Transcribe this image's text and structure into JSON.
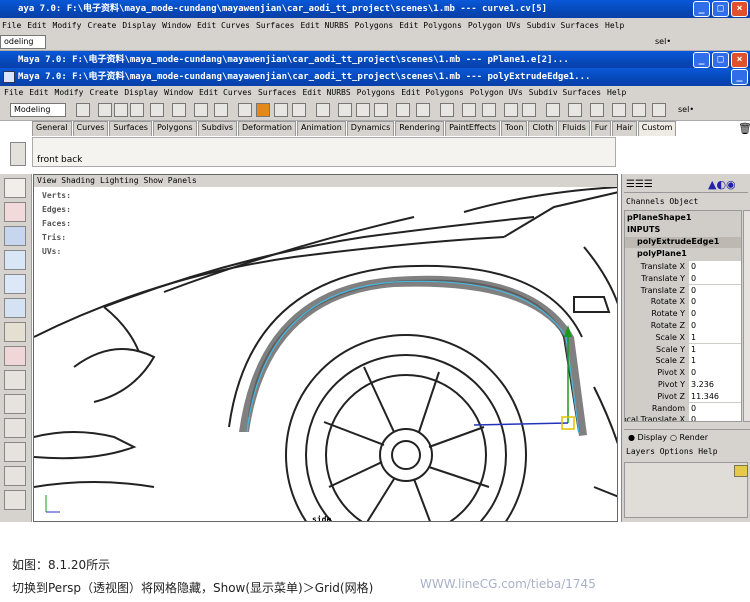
{
  "back_window": {
    "title": "aya 7.0: F:\\电子资料\\maya_mode-cundang\\mayawenjian\\car_aodi_tt_project\\scenes\\1.mb    ---    curve1.cv[5]",
    "menu": [
      "File",
      "Edit",
      "Modify",
      "Create",
      "Display",
      "Window",
      "Edit Curves",
      "Surfaces",
      "Edit NURBS",
      "Polygons",
      "Edit Polygons",
      "Polygon UVs",
      "Subdiv Surfaces",
      "Help"
    ],
    "mode_select": "odeling",
    "sel_label": "sel•"
  },
  "mid_window": {
    "title": "Maya 7.0: F:\\电子资料\\maya_mode-cundang\\mayawenjian\\car_aodi_tt_project\\scenes\\1.mb    ---    pPlane1.e[2]..."
  },
  "front_window": {
    "title": "Maya 7.0: F:\\电子资料\\maya_mode-cundang\\mayawenjian\\car_aodi_tt_project\\scenes\\1.mb    ---    polyExtrudeEdge1...",
    "menu": [
      "File",
      "Edit",
      "Modify",
      "Create",
      "Display",
      "Window",
      "Edit Curves",
      "Surfaces",
      "Edit NURBS",
      "Polygons",
      "Edit Polygons",
      "Polygon UVs",
      "Subdiv Surfaces",
      "Help"
    ],
    "mode_select": "Modeling",
    "sel_label": "sel•"
  },
  "shelf": {
    "tabs": [
      "General",
      "Curves",
      "Surfaces",
      "Polygons",
      "Subdivs",
      "Deformation",
      "Animation",
      "Dynamics",
      "Rendering",
      "PaintEffects",
      "Toon",
      "Cloth",
      "Fluids",
      "Fur",
      "Hair",
      "Custom"
    ],
    "items": [
      "front",
      "back"
    ]
  },
  "viewport": {
    "menu": [
      "View",
      "Shading",
      "Lighting",
      "Show",
      "Panels"
    ],
    "hud": [
      "Verts:",
      "Edges:",
      "Faces:",
      "Tris:",
      "UVs:"
    ],
    "bottom_label": "side"
  },
  "channel_box": {
    "tabs": [
      "Channels",
      "Object"
    ],
    "object": "pPlaneShape1",
    "inputs_label": "INPUTS",
    "nodes": [
      "polyExtrudeEdge1",
      "polyPlane1"
    ],
    "attrs": [
      {
        "name": "Translate X",
        "value": "0"
      },
      {
        "name": "Translate Y",
        "value": "0"
      },
      {
        "name": "Translate Z",
        "value": "0"
      },
      {
        "name": "Rotate X",
        "value": "0"
      },
      {
        "name": "Rotate Y",
        "value": "0"
      },
      {
        "name": "Rotate Z",
        "value": "0"
      },
      {
        "name": "Scale X",
        "value": "1"
      },
      {
        "name": "Scale Y",
        "value": "1"
      },
      {
        "name": "Scale Z",
        "value": "1"
      },
      {
        "name": "Pivot X",
        "value": "0"
      },
      {
        "name": "Pivot Y",
        "value": "3.236"
      },
      {
        "name": "Pivot Z",
        "value": "11.346"
      },
      {
        "name": "Random",
        "value": "0"
      },
      {
        "name": "Local Translate X",
        "value": "0"
      }
    ],
    "display_radio": "Display",
    "render_radio": "Render",
    "layer_menu": [
      "Layers",
      "Options",
      "Help"
    ]
  },
  "caption": {
    "line1": "如图：8.1.20所示",
    "line2": "切换到Persp（透视图）将网格隐藏，Show(显示菜单)＞Grid(网格)",
    "watermark": "WWW.lineCG.com/tieba/1745"
  }
}
